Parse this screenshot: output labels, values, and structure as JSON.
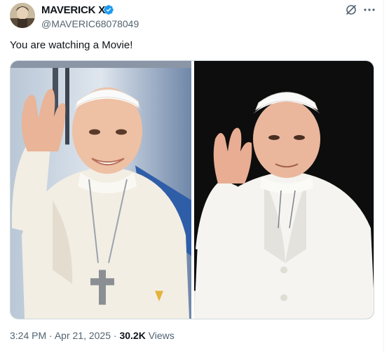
{
  "post": {
    "display_name": "MAVERICK X",
    "handle": "@MAVERIC68078049",
    "text": "You are watching a Movie!",
    "time": "3:24 PM",
    "date": "Apr 21, 2025",
    "separator": "·",
    "views_count": "30.2K",
    "views_label": "Views"
  },
  "icons": {
    "verified": "verified-badge-icon",
    "grok": "grok-icon",
    "more": "more-options-icon"
  },
  "colors": {
    "verified_blue": "#1d9bf0",
    "secondary_text": "#536471",
    "primary_text": "#0f1419"
  }
}
